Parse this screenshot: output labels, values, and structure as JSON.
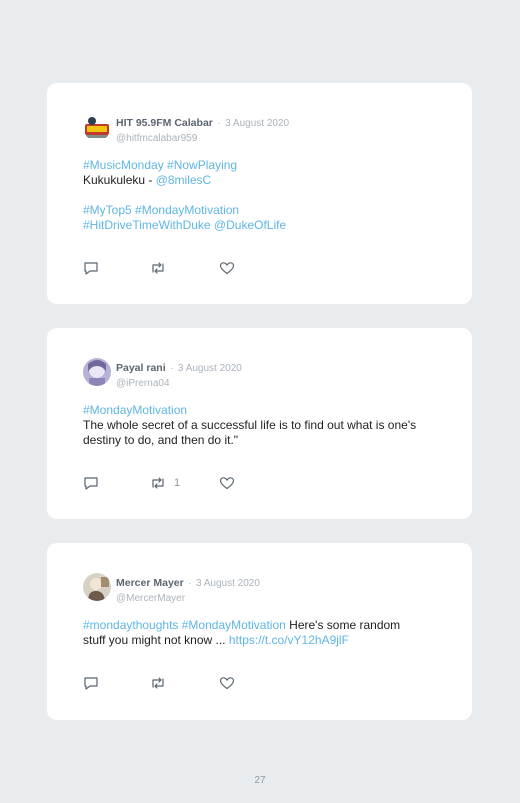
{
  "tweets": [
    {
      "name": "HIT 95.9FM Calabar",
      "date": "3 August 2020",
      "handle": "@hitfmcalabar959",
      "line1_a": "#MusicMonday",
      "line1_b": "#NowPlaying",
      "line2_text": "Kukukuleku - ",
      "line2_link": "@8milesC",
      "line3_a": "#MyTop5",
      "line3_b": "#MondayMotivation",
      "line4_a": "#HitDriveTimeWithDuke",
      "line4_b": "@DukeOfLife"
    },
    {
      "name": "Payal rani",
      "date": "3 August 2020",
      "handle": "@iPrerna04",
      "hashtag": "#MondayMotivation",
      "text": "The whole secret of a successful life is to find out what is one's destiny to do, and then do it.\"",
      "retweets": "1"
    },
    {
      "name": "Mercer Mayer",
      "date": "3 August 2020",
      "handle": "@MercerMayer",
      "hashtag_a": "#mondaythoughts",
      "hashtag_b": "#MondayMotivation",
      "text_a": "Here's some random",
      "text_b": "stuff you might not know ... ",
      "url": "https://t.co/vY12hA9jlF"
    }
  ],
  "sep": "·",
  "page_number": "27",
  "icons": [
    "reply-icon",
    "retweet-icon",
    "like-icon"
  ],
  "colors": {
    "link": "#5fb6e4",
    "background": "#e9ecef",
    "card": "#ffffff"
  }
}
